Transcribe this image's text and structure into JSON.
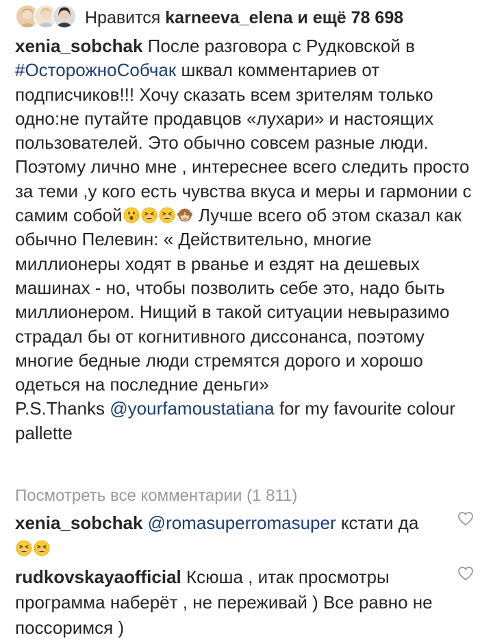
{
  "likes": {
    "prefix": "Нравится",
    "user": "karneeva_elena",
    "suffix": "и ещё 78 698"
  },
  "caption": {
    "author": "xenia_sobchak",
    "text_a": "После разговора  с Рудковской в",
    "hashtag": "#ОсторожноСобчак",
    "text_b": "шквал комментариев от подписчиков!!! Хочу сказать всем зрителям только одно:не путайте продавцов «лухари» и настоящих пользователей. Это обычно совсем разные люди. Поэтому лично мне , интереснее всего следить просто за теми ,у кого есть чувства вкуса и меры и гармонии с самим собой",
    "text_c": "Лучше всего об этом сказал как обычно Пелевин: « Действительно, многие миллионеры ходят в рванье и ездят на дешевых машинах - но, чтобы позволить себе это, надо быть миллионером. Нищий в такой ситуации невыразимо страдал бы от когнитивного диссонанса, поэтому многие бедные люди стремятся дорого и хорошо одеться на последние деньги»",
    "ps_prefix": "P.S.Thanks",
    "ps_mention": "@yourfamoustatiana",
    "ps_suffix": "for my favourite colour pallette"
  },
  "view_all_comments": "Посмотреть все комментарии (1 811)",
  "comments": [
    {
      "user": "xenia_sobchak",
      "mention": "@romasuperromasuper",
      "text": "кстати да"
    },
    {
      "user": "rudkovskayaofficial",
      "text": "Ксюша , итак просмотры программа наберёт , не переживай ) Все равно не поссоримся )"
    }
  ],
  "colors": {
    "text": "#262626",
    "link": "#1b3f73",
    "muted": "#9a9a9a"
  },
  "icons": {
    "liker_avatars": "avatar",
    "emoji_1": "face-with-open-mouth-emoji",
    "emoji_laugh": "grinning-squinting-face-emoji",
    "emoji_monkey": "see-no-evil-monkey-emoji",
    "like": "heart-outline-icon"
  }
}
